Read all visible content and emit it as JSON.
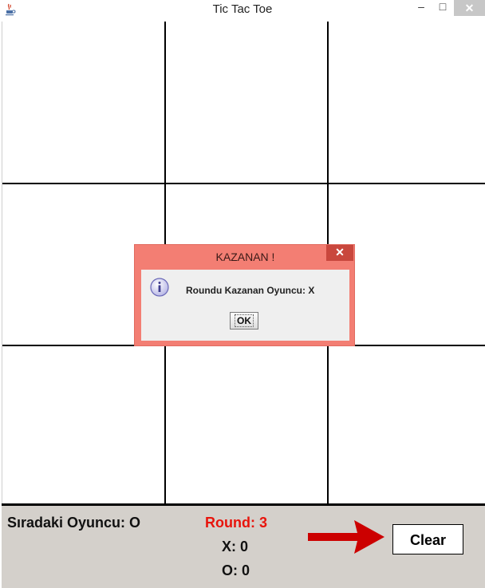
{
  "window": {
    "title": "Tic Tac Toe",
    "controls": {
      "minimize": "–",
      "maximize": "□",
      "close": "✕"
    },
    "icon": "java-cup-icon"
  },
  "board": {
    "rows": 3,
    "cols": 3,
    "cells": [
      [
        "",
        "",
        ""
      ],
      [
        "",
        "",
        ""
      ],
      [
        "",
        "",
        ""
      ]
    ],
    "line_color": "#000000"
  },
  "status": {
    "next_player": "Sıradaki Oyuncu: O",
    "round": "Round: 3",
    "score_x": "X: 0",
    "score_o": "O: 0",
    "round_color": "#e8140c",
    "arrow_color": "#cc0000",
    "clear_label": "Clear"
  },
  "dialog": {
    "title": "KAZANAN !",
    "message": "Roundu Kazanan Oyuncu: X",
    "ok_label": "OK",
    "close_symbol": "✕",
    "icon": "info-icon"
  }
}
